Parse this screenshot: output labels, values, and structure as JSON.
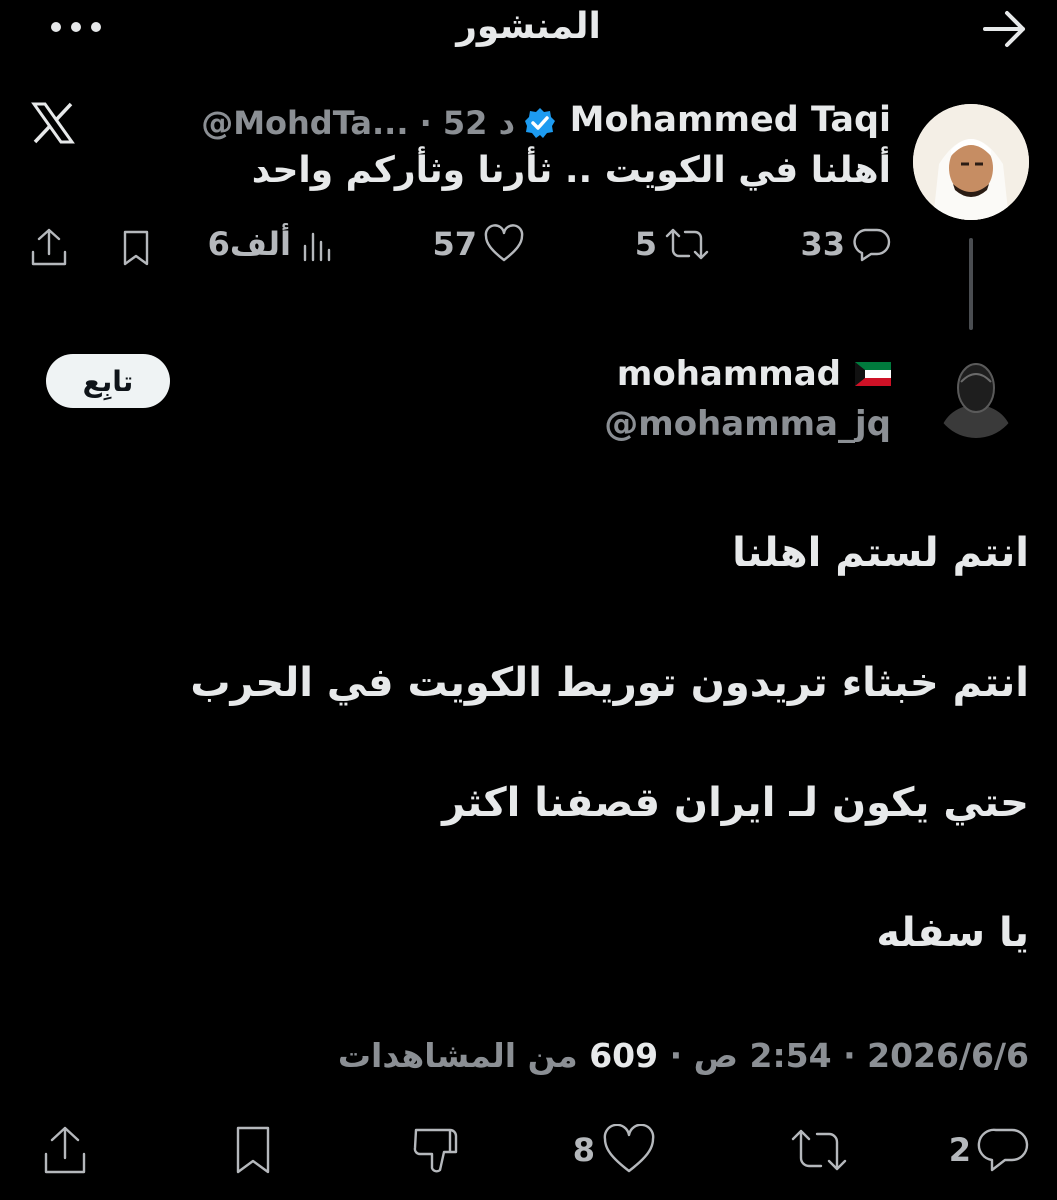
{
  "header": {
    "title": "المنشور"
  },
  "parent_tweet": {
    "author_name": "Mohammed Taqi",
    "handle_truncated": "@MohdTa...",
    "separator": "·",
    "age": "52 د",
    "text": "أهلنا في الكويت .. ثأرنا وثأركم واحد",
    "replies": "33",
    "retweets": "5",
    "likes": "57",
    "views": "6ألف"
  },
  "reply_tweet": {
    "author_name": "mohammad",
    "handle": "@mohamma_jq",
    "follow_label": "تابِع",
    "lines": [
      "انتم لستم اهلنا",
      "انتم خبثاء تريدون توريط الكويت في الحرب",
      "حتي يكون لـ ايران قصفنا اكثر",
      "يا سفله"
    ],
    "timestamp_prefix": "2026/6/6 · 2:54 ص · ",
    "views_count": "609",
    "views_label": " من المشاهدات",
    "replies": "2",
    "likes": "8"
  },
  "icons": {
    "back": "arrow-right-icon",
    "more": "more-horizontal-icon",
    "platform": "x-logo-icon",
    "verified": "verified-badge-icon",
    "reply": "reply-icon",
    "retweet": "retweet-icon",
    "like": "heart-icon",
    "views": "views-icon",
    "bookmark": "bookmark-icon",
    "share": "share-icon",
    "dislike": "dislike-icon",
    "flag": "kuwait-flag-icon"
  },
  "colors": {
    "background": "#000000",
    "text_primary": "#e7e9ea",
    "text_secondary": "#8b8f94",
    "verified_blue": "#1d9bf0",
    "follow_bg": "#eff3f4"
  }
}
